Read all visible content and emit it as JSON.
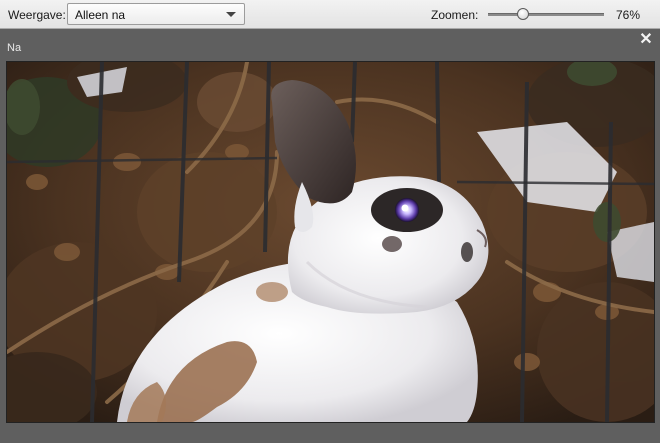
{
  "toolbar": {
    "view_label": "Weergave:",
    "view_selected": "Alleen na",
    "zoom_label": "Zoomen:",
    "zoom_value": "76%",
    "zoom_fraction": 0.3
  },
  "panel": {
    "title": "Na",
    "close_icon": "close-icon"
  },
  "photo": {
    "subject": "white rabbit with brown spots in front of fence and brown foliage"
  },
  "colors": {
    "toolbar_bg": "#e8e8e8",
    "panel_bg": "#5f5f5f"
  }
}
